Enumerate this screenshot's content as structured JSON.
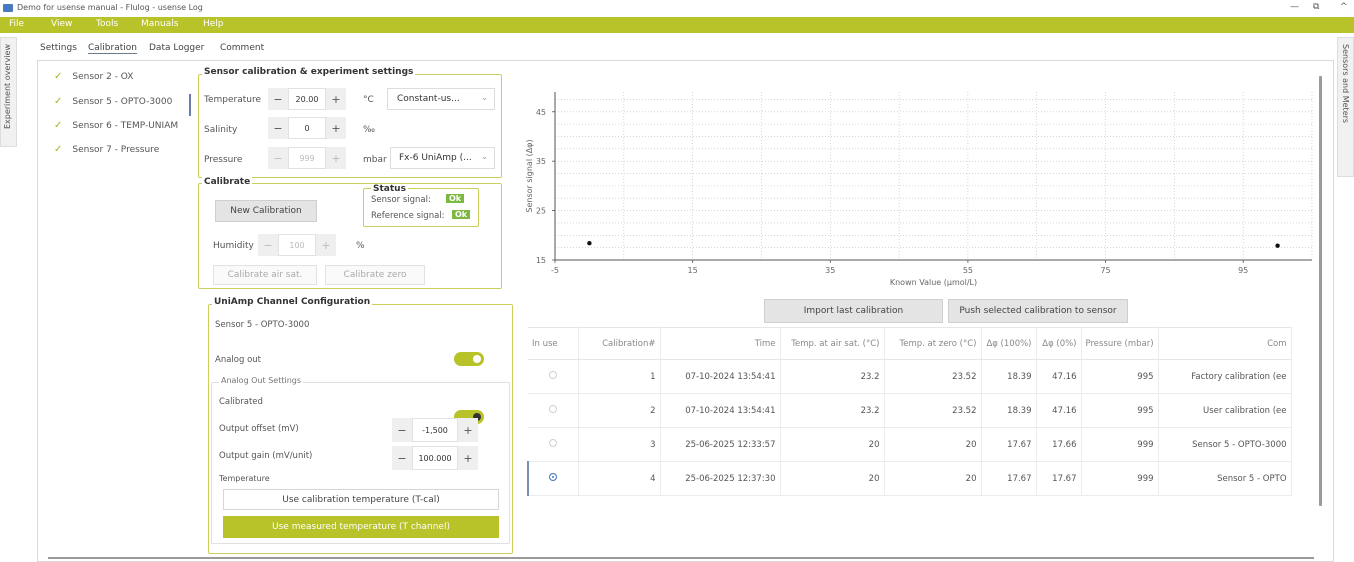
{
  "window": {
    "title": "Demo for usense manual - Flulog - usense Log",
    "controls": [
      "—",
      "⧉",
      "^"
    ]
  },
  "menu": [
    "File",
    "View",
    "Tools",
    "Manuals",
    "Help"
  ],
  "rails": {
    "left": "Experiment overview",
    "right": "Sensors and Meters"
  },
  "tabs": [
    {
      "label": "Settings",
      "active": false
    },
    {
      "label": "Calibration",
      "active": true
    },
    {
      "label": "Data Logger",
      "active": false
    },
    {
      "label": "Comment",
      "active": false
    }
  ],
  "sensors": [
    {
      "check": "✓",
      "label": "Sensor 2 - OX"
    },
    {
      "check": "✓",
      "label": "Sensor 5 - OPTO-3000",
      "selected": true
    },
    {
      "check": "✓",
      "label": "Sensor 6 - TEMP-UNIAM"
    },
    {
      "check": "✓",
      "label": "Sensor 7 - Pressure"
    }
  ],
  "settings": {
    "title": "Sensor calibration & experiment settings",
    "temperature": {
      "label": "Temperature",
      "value": "20.00",
      "unit": "°C",
      "mode": "Constant-us..."
    },
    "salinity": {
      "label": "Salinity",
      "value": "0",
      "unit": "‰"
    },
    "pressure": {
      "label": "Pressure",
      "value": "999",
      "unit": "mbar",
      "source": "Fx-6 UniAmp (..."
    }
  },
  "calibrate": {
    "title": "Calibrate",
    "new_button": "New Calibration",
    "humidity": {
      "label": "Humidity",
      "value": "100",
      "unit": "%"
    },
    "air_button": "Calibrate air sat.",
    "zero_button": "Calibrate zero",
    "status": {
      "title": "Status",
      "sensor_label": "Sensor signal:",
      "sensor_value": "Ok",
      "reference_label": "Reference signal:",
      "reference_value": "Ok"
    }
  },
  "uniamp": {
    "title": "UniAmp Channel Configuration",
    "sensor": "Sensor 5 - OPTO-3000",
    "analog_out_label": "Analog out",
    "analog_out_on": true,
    "settings_title": "Analog Out Settings",
    "calibrated_label": "Calibrated",
    "calibrated_on": true,
    "offset": {
      "label": "Output offset (mV)",
      "value": "-1,500"
    },
    "gain": {
      "label": "Output gain (mV/unit)",
      "value": "100.000"
    },
    "temperature_label": "Temperature",
    "use_cal_temp": "Use calibration temperature (T-cal)",
    "use_measured_temp": "Use measured temperature (T channel)"
  },
  "chart_data": {
    "type": "scatter",
    "xlabel": "Known Value (µmol/L)",
    "ylabel": "Sensor signal (Δφ)",
    "xlim": [
      -5,
      105
    ],
    "ylim": [
      15,
      49
    ],
    "xticks": [
      "-5",
      "15",
      "35",
      "55",
      "75",
      "95"
    ],
    "yticks": [
      "15",
      "25",
      "35",
      "45"
    ],
    "grid": true,
    "points": [
      {
        "x": 0,
        "y": 18.4
      },
      {
        "x": 100,
        "y": 17.9
      }
    ]
  },
  "chart_buttons": {
    "import": "Import last calibration",
    "push": "Push selected calibration to sensor"
  },
  "table": {
    "headers": [
      "In use",
      "Calibration#",
      "Time",
      "Temp. at air sat. (°C)",
      "Temp. at zero (°C)",
      "Δφ (100%)",
      "Δφ (0%)",
      "Pressure (mbar)",
      "Com"
    ],
    "rows": [
      {
        "in_use": false,
        "num": "1",
        "time": "07-10-2024 13:54:41",
        "temp_air": "23.2",
        "temp_zero": "23.52",
        "d100": "18.39",
        "d0": "47.16",
        "pressure": "995",
        "comment": "Factory calibration (ee"
      },
      {
        "in_use": false,
        "num": "2",
        "time": "07-10-2024 13:54:41",
        "temp_air": "23.2",
        "temp_zero": "23.52",
        "d100": "18.39",
        "d0": "47.16",
        "pressure": "995",
        "comment": "User calibration (ee"
      },
      {
        "in_use": false,
        "num": "3",
        "time": "25-06-2025 12:33:57",
        "temp_air": "20",
        "temp_zero": "20",
        "d100": "17.67",
        "d0": "17.66",
        "pressure": "999",
        "comment": "Sensor 5 - OPTO-3000"
      },
      {
        "in_use": true,
        "num": "4",
        "time": "25-06-2025 12:37:30",
        "temp_air": "20",
        "temp_zero": "20",
        "d100": "17.67",
        "d0": "17.67",
        "pressure": "999",
        "comment": "Sensor 5 - OPTO"
      }
    ]
  },
  "colors": {
    "accent": "#b8c229",
    "ok": "#7db843",
    "selection": "#4a78c2"
  }
}
